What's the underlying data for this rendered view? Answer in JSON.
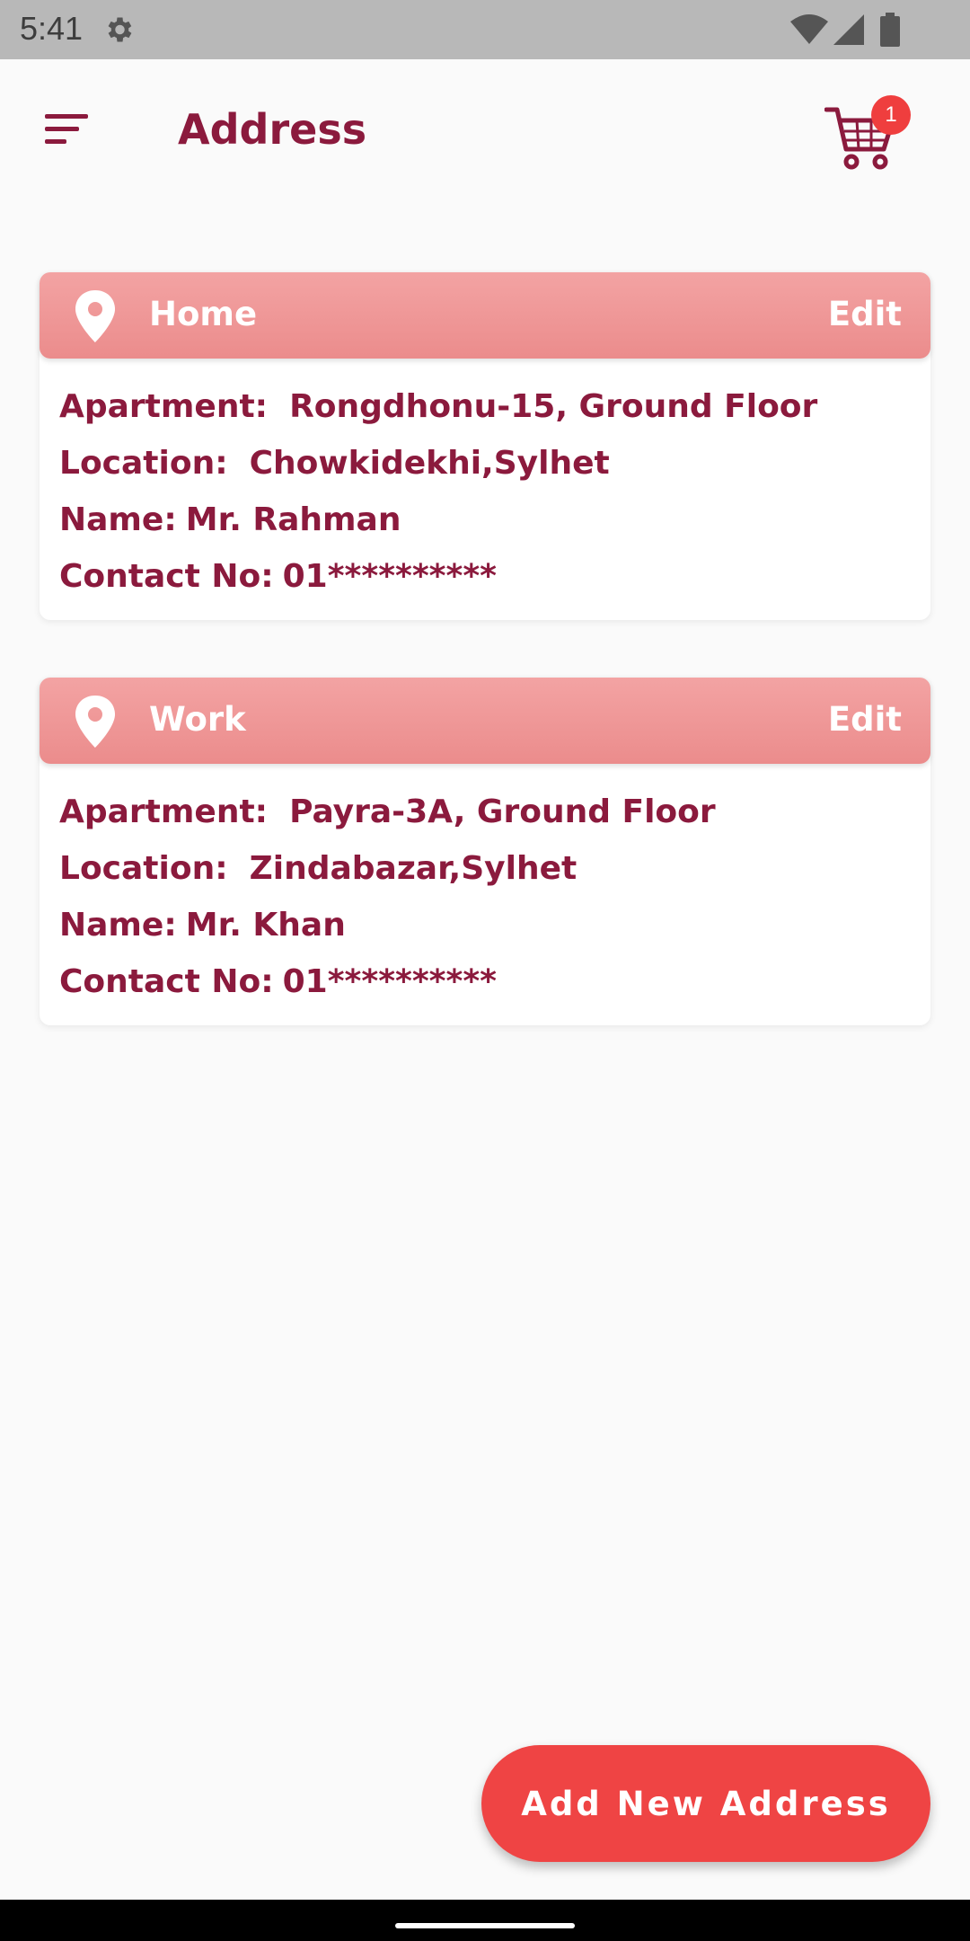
{
  "status_bar": {
    "time": "5:41"
  },
  "header": {
    "title": "Address",
    "cart_count": "1"
  },
  "colors": {
    "accent_text": "#8b1a3d",
    "card_header": "#ef9292",
    "button": "#ef4444",
    "badge": "#ef3e3e"
  },
  "addresses": [
    {
      "label": "Home",
      "edit_label": "Edit",
      "apartment_label": "Apartment:",
      "apartment_value": "Rongdhonu-15, Ground Floor",
      "location_label": "Location:",
      "location_value": "Chowkidekhi,Sylhet",
      "name_label": "Name:",
      "name_value": "Mr. Rahman",
      "contact_label": "Contact No:",
      "contact_value": "01**********"
    },
    {
      "label": "Work",
      "edit_label": "Edit",
      "apartment_label": "Apartment:",
      "apartment_value": "Payra-3A, Ground Floor",
      "location_label": "Location:",
      "location_value": "Zindabazar,Sylhet",
      "name_label": "Name:",
      "name_value": "Mr. Khan",
      "contact_label": "Contact No:",
      "contact_value": "01**********"
    }
  ],
  "add_button_label": "Add New Address",
  "icons": {
    "status": [
      "gear-icon",
      "wifi-icon",
      "signal-icon",
      "battery-icon"
    ],
    "header": [
      "menu-icon",
      "cart-icon"
    ],
    "card": "location-pin-icon"
  }
}
